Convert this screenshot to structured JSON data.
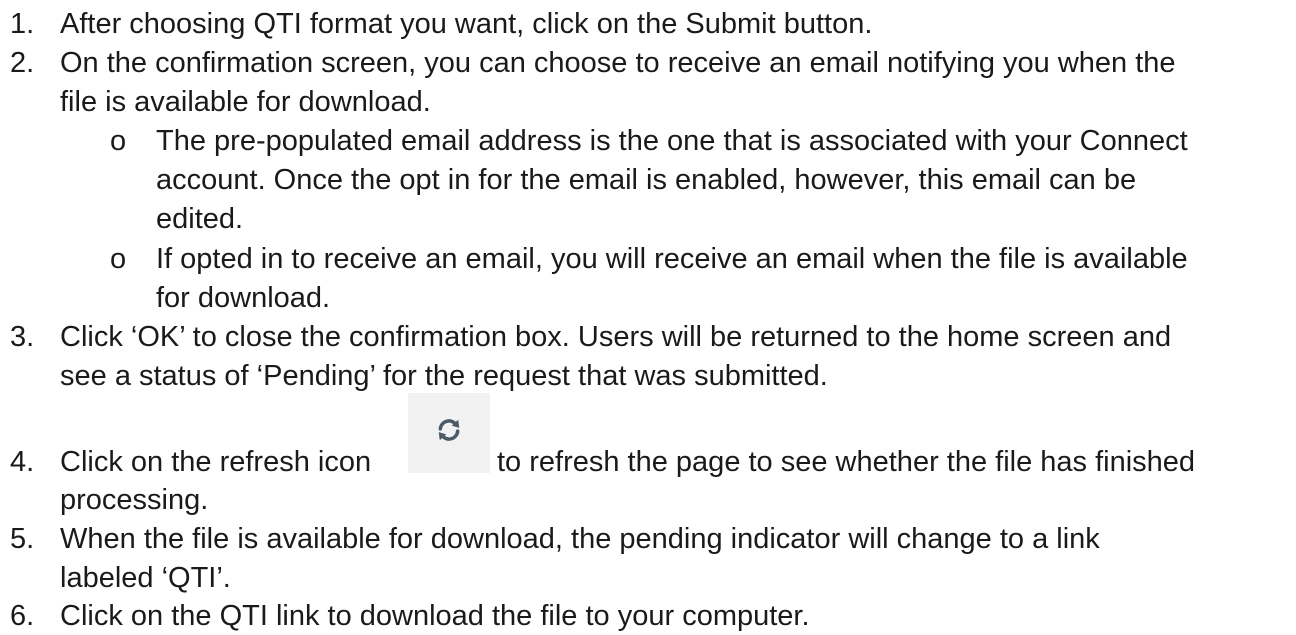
{
  "steps": [
    {
      "num": "1.",
      "lines": [
        "After choosing QTI format you want, click on the Submit button."
      ]
    },
    {
      "num": "2.",
      "lines": [
        "On the confirmation screen, you can choose to receive an email notifying you when the",
        "file is available for download."
      ],
      "bullets": [
        {
          "marker": "o",
          "lines": [
            "The pre-populated email address is the one that is associated with your Connect",
            "account. Once the opt in for the email is enabled, however, this email can be",
            "edited."
          ]
        },
        {
          "marker": "o",
          "lines": [
            "If opted in to receive an email, you will receive an email when the file is available",
            "for download."
          ]
        }
      ]
    },
    {
      "num": "3.",
      "lines": [
        "Click ‘OK’ to close the confirmation box. Users will be returned to the home screen and",
        "see a status of ‘Pending’ for the request that was submitted."
      ]
    },
    {
      "num": "4.",
      "lines": [
        "Click on the refresh icon",
        "to refresh the page to see whether the file has finished",
        "processing."
      ]
    },
    {
      "num": "5.",
      "lines": [
        "When the file is available for download, the pending indicator will change to a link",
        "labeled ‘QTI’."
      ]
    },
    {
      "num": "6.",
      "lines": [
        "Click on the QTI link to download the file to your computer."
      ]
    }
  ],
  "icons": {
    "refresh": "refresh-icon"
  },
  "colors": {
    "text": "#1a1a1a",
    "icon_bg": "#f2f2f2",
    "icon": "#4a5a66"
  }
}
